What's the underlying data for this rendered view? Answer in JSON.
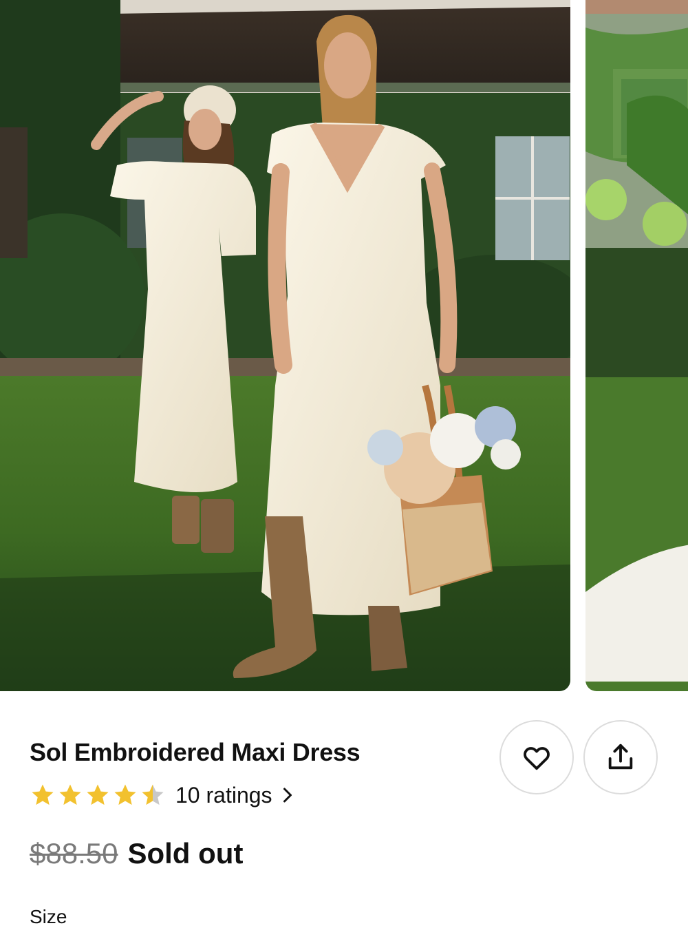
{
  "gallery": {
    "images": [
      {
        "icon": "product-photo-two-models-in-white-dresses"
      },
      {
        "icon": "product-photo-dress-hem-on-grass"
      }
    ]
  },
  "product": {
    "title": "Sol Embroidered Maxi Dress",
    "rating_value": 4.5,
    "rating_max": 5,
    "ratings_label": "10 ratings",
    "original_price": "$88.50",
    "availability": "Sold out",
    "size_label": "Size"
  },
  "actions": {
    "favorite_icon": "heart-icon",
    "share_icon": "share-icon"
  },
  "colors": {
    "star": "#F2C12E",
    "star_empty": "#C8C8C8",
    "text": "#111111",
    "muted": "#7A7A7A",
    "border": "#DCDCDC"
  }
}
